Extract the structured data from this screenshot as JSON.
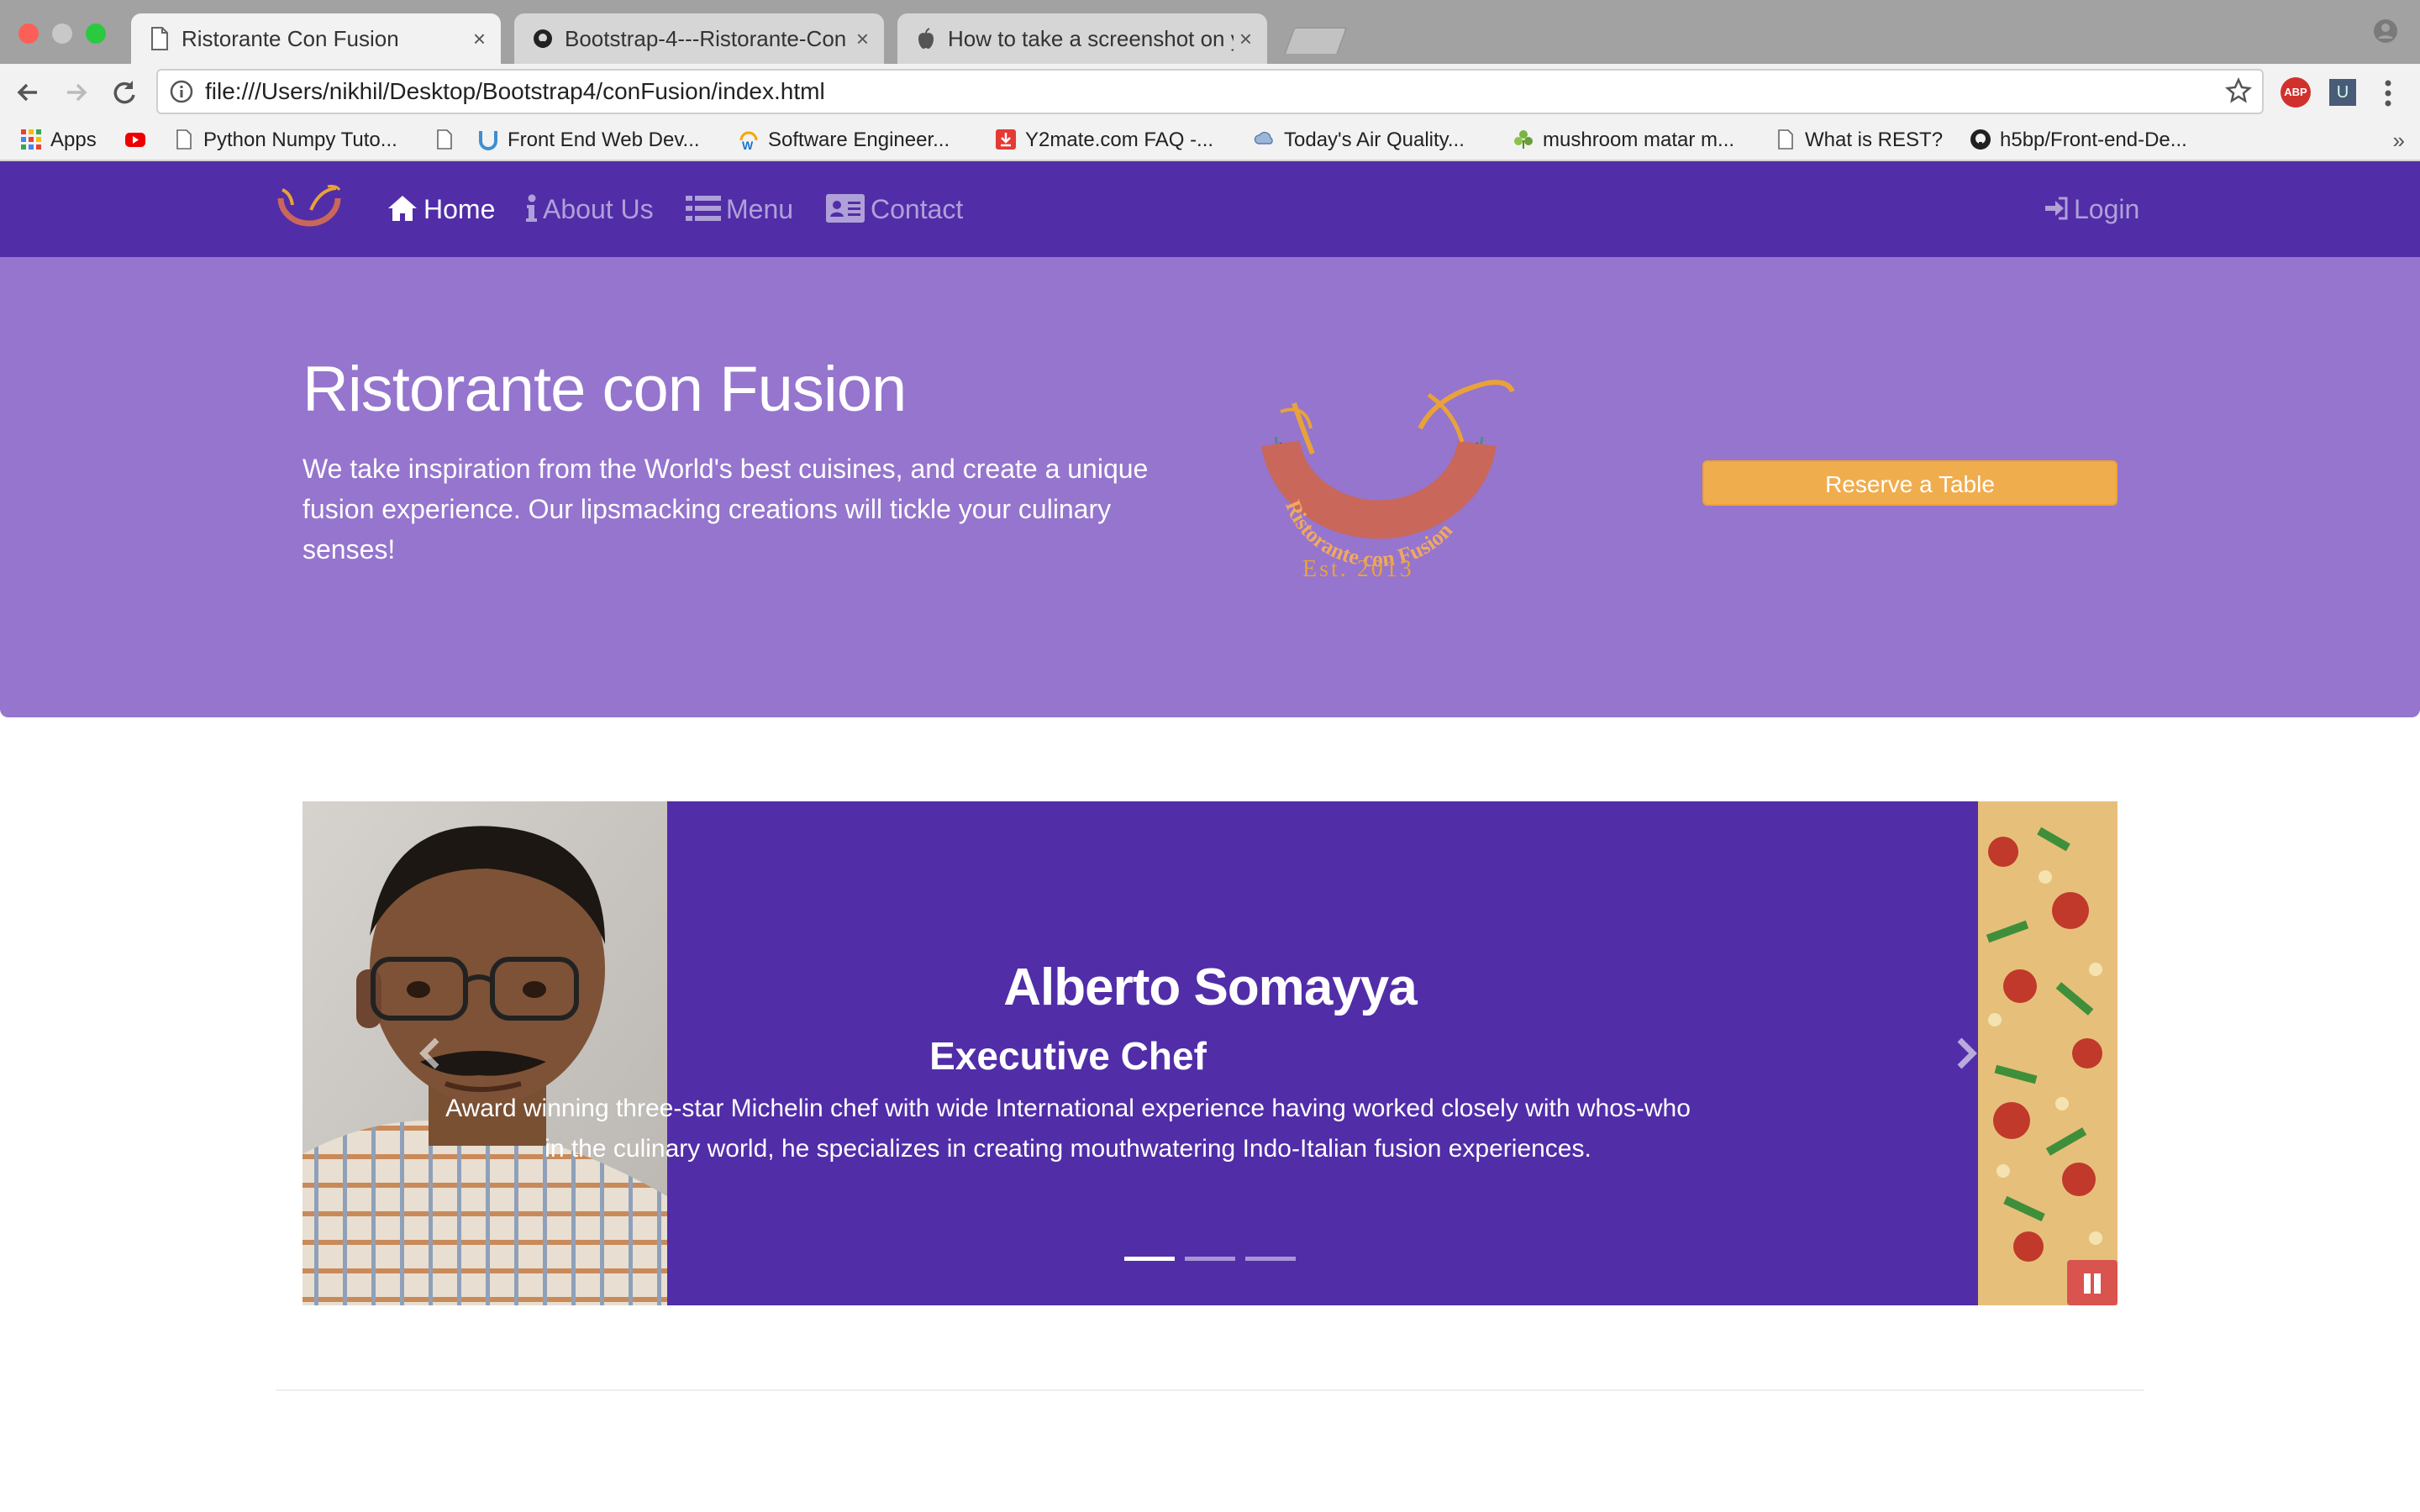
{
  "browser": {
    "tabs": [
      {
        "title": "Ristorante Con Fusion",
        "active": true,
        "icon": "page-icon"
      },
      {
        "title": "Bootstrap-4---Ristorante-Con",
        "active": false,
        "icon": "github-icon"
      },
      {
        "title": "How to take a screenshot on y",
        "active": false,
        "icon": "apple-icon"
      }
    ],
    "url": "file:///Users/nikhil/Desktop/Bootstrap4/conFusion/index.html",
    "extensions": {
      "abp_label": "ABP",
      "u_label": "U"
    },
    "bookmarks": [
      {
        "label": "Apps",
        "icon": "apps-grid-icon"
      },
      {
        "label": "",
        "icon": "youtube-icon"
      },
      {
        "label": "Python Numpy Tuto...",
        "icon": "page-icon"
      },
      {
        "label": "",
        "icon": "page-icon"
      },
      {
        "label": "Front End Web Dev...",
        "icon": "coursera-icon"
      },
      {
        "label": "Software Engineer...",
        "icon": "w-icon"
      },
      {
        "label": "Y2mate.com FAQ -...",
        "icon": "download-icon"
      },
      {
        "label": "Today's Air Quality...",
        "icon": "cloud-icon"
      },
      {
        "label": "mushroom matar m...",
        "icon": "leaf-icon"
      },
      {
        "label": "What is REST?",
        "icon": "page-icon"
      },
      {
        "label": "h5bp/Front-end-De...",
        "icon": "github-icon"
      }
    ],
    "more_label": "»"
  },
  "navbar": {
    "items": [
      {
        "label": "Home",
        "icon": "home-icon",
        "active": true
      },
      {
        "label": "About Us",
        "icon": "info-icon",
        "active": false
      },
      {
        "label": "Menu",
        "icon": "list-icon",
        "active": false
      },
      {
        "label": "Contact",
        "icon": "address-card-icon",
        "active": false
      }
    ],
    "login": {
      "label": "Login",
      "icon": "sign-in-icon"
    }
  },
  "jumbotron": {
    "title": "Ristorante con Fusion",
    "text": "We take inspiration from the World's best cuisines, and create a unique fusion experience. Our lipsmacking creations will tickle your culinary senses!",
    "logo_text": "Ristorante con Fusion",
    "logo_est": "Est. 2013",
    "reserve_label": "Reserve a Table"
  },
  "carousel": {
    "title": "Alberto Somayya",
    "subtitle": "Executive Chef",
    "text": "Award winning three-star Michelin chef with wide International experience having worked closely with whos-who in the culinary world, he specializes in creating mouthwatering Indo-Italian fusion experiences.",
    "active_index": 0,
    "slide_count": 3
  },
  "colors": {
    "primary": "#512da8",
    "jumbotron": "#9575cd",
    "warning": "#f0ad4e",
    "danger": "#d9534f"
  }
}
